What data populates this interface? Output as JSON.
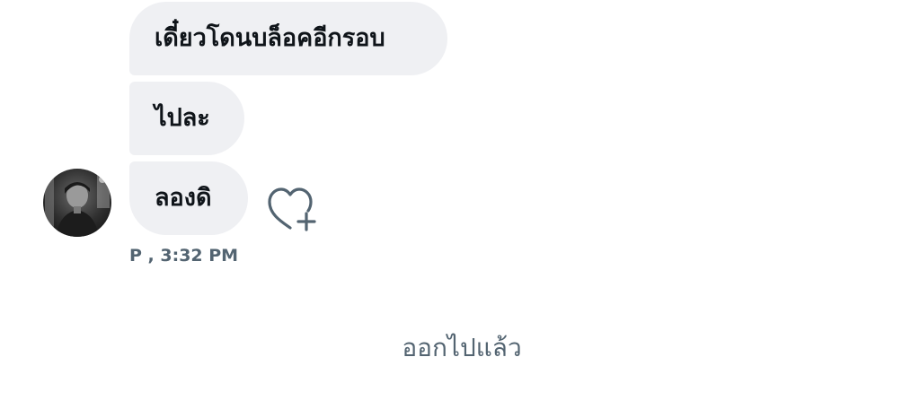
{
  "messages": [
    {
      "text": "เดี๋ยวโดนบล็อคอีกรอบ"
    },
    {
      "text": "ไปละ"
    },
    {
      "text": "ลองดิ"
    }
  ],
  "meta": {
    "sender": "P",
    "time": "3:32 PM",
    "line": "P , 3:32 PM"
  },
  "system_note": {
    "text": "ออกไปแล้ว"
  },
  "icons": {
    "reaction": "heart-plus-icon",
    "avatar": "user-avatar"
  },
  "colors": {
    "bubble": "#eff0f3",
    "text": "#0f1419",
    "meta": "#536471",
    "icon": "#536471"
  }
}
